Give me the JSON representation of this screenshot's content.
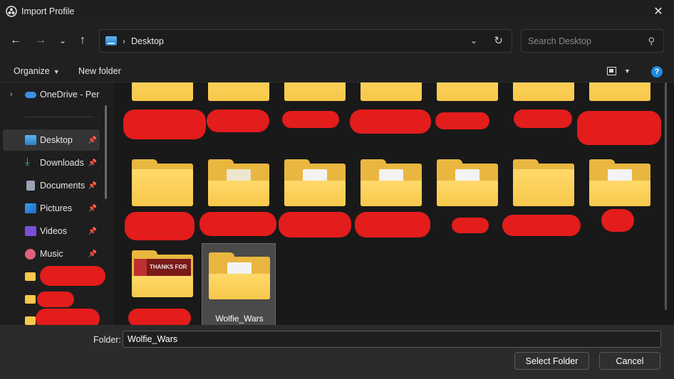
{
  "window": {
    "title": "Import Profile"
  },
  "nav": {
    "breadcrumb": [
      "Desktop"
    ],
    "search_placeholder": "Search Desktop"
  },
  "toolbar": {
    "organize_label": "Organize",
    "new_folder_label": "New folder"
  },
  "sidebar": {
    "onedrive_label": "OneDrive - Perso",
    "items": [
      {
        "label": "Desktop",
        "pinned": true,
        "selected": true,
        "icon": "desktop-icon"
      },
      {
        "label": "Downloads",
        "pinned": true,
        "icon": "download-icon"
      },
      {
        "label": "Documents",
        "pinned": true,
        "icon": "documents-icon"
      },
      {
        "label": "Pictures",
        "pinned": true,
        "icon": "pictures-icon"
      },
      {
        "label": "Videos",
        "pinned": true,
        "icon": "videos-icon"
      },
      {
        "label": "Music",
        "pinned": true,
        "icon": "music-icon"
      }
    ]
  },
  "content": {
    "visible_label": "Wolfie_Wars",
    "thumbnail_text": "THANKS FOR"
  },
  "bottom": {
    "folder_label": "Folder:",
    "folder_value": "Wolfie_Wars",
    "select_button": "Select Folder",
    "cancel_button": "Cancel"
  },
  "colors": {
    "accent": "#1f8ae0",
    "folder": "#f7c84a",
    "redaction": "#e31c1c"
  }
}
